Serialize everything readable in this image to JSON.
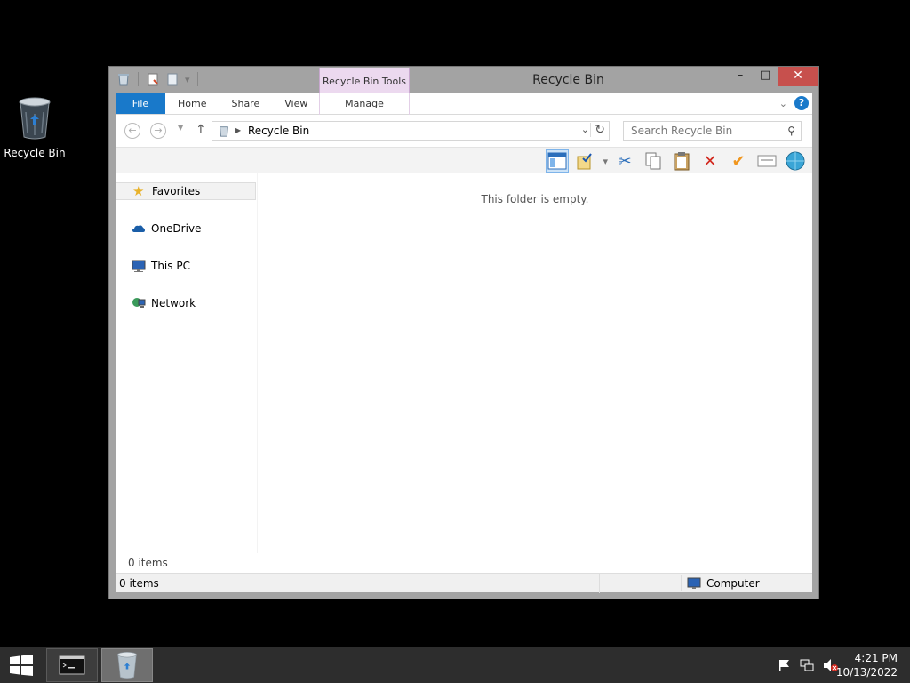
{
  "desktop": {
    "recycle_bin_label": "Recycle Bin"
  },
  "window": {
    "title": "Recycle Bin",
    "contextual_tab_group": "Recycle Bin Tools",
    "controls": {
      "minimize": "–",
      "maximize": "□",
      "close": "✕"
    },
    "ribbon_tabs": [
      "File",
      "Home",
      "Share",
      "View"
    ],
    "manage_tab": "Manage",
    "address": {
      "crumb": "Recycle Bin"
    },
    "search": {
      "placeholder": "Search Recycle Bin"
    },
    "nav_pane": [
      {
        "label": "Favorites",
        "icon": "star-icon"
      },
      {
        "label": "OneDrive",
        "icon": "cloud-icon"
      },
      {
        "label": "This PC",
        "icon": "computer-icon"
      },
      {
        "label": "Network",
        "icon": "network-icon"
      }
    ],
    "empty_message": "This folder is empty.",
    "item_count": "0 items",
    "statusbar": {
      "left": "0 items",
      "location": "Computer"
    }
  },
  "taskbar": {
    "time": "4:21 PM",
    "date": "10/13/2022"
  },
  "colors": {
    "file_tab": "#1979ca",
    "close_button": "#c7504d",
    "contextual": "#ecd9ef"
  }
}
